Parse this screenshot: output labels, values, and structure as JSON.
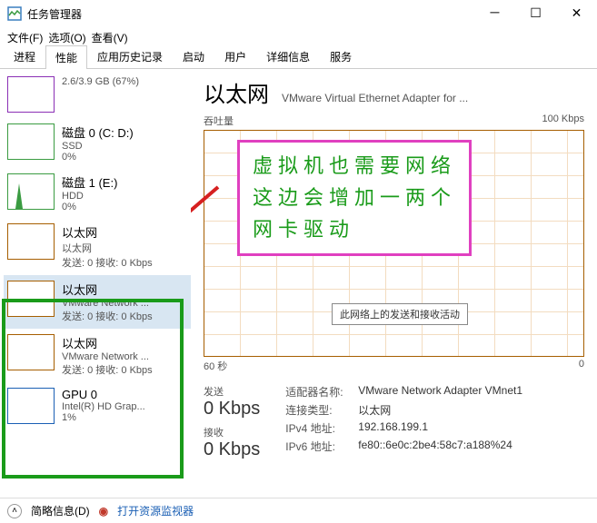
{
  "window": {
    "title": "任务管理器"
  },
  "menu": {
    "file": "文件(F)",
    "options": "选项(O)",
    "view": "查看(V)"
  },
  "tabs": {
    "processes": "进程",
    "performance": "性能",
    "app_history": "应用历史记录",
    "startup": "启动",
    "users": "用户",
    "details": "详细信息",
    "services": "服务"
  },
  "sidebar": [
    {
      "title": "",
      "sub": "2.6/3.9 GB (67%)",
      "sub2": "",
      "thumbClass": "thumb-mem"
    },
    {
      "title": "磁盘 0 (C: D:)",
      "sub": "SSD",
      "sub2": "0%",
      "thumbClass": "thumb-disk"
    },
    {
      "title": "磁盘 1 (E:)",
      "sub": "HDD",
      "sub2": "0%",
      "thumbClass": "thumb-disk",
      "spike": true
    },
    {
      "title": "以太网",
      "sub": "以太网",
      "sub2": "发送: 0 接收: 0 Kbps",
      "thumbClass": "thumb-eth"
    },
    {
      "title": "以太网",
      "sub": "VMware Network ...",
      "sub2": "发送: 0 接收: 0 Kbps",
      "thumbClass": "thumb-eth",
      "selected": true
    },
    {
      "title": "以太网",
      "sub": "VMware Network ...",
      "sub2": "发送: 0 接收: 0 Kbps",
      "thumbClass": "thumb-eth"
    },
    {
      "title": "GPU 0",
      "sub": "Intel(R) HD Grap...",
      "sub2": "1%",
      "thumbClass": "thumb-gpu"
    }
  ],
  "main": {
    "title": "以太网",
    "subtitle": "VMware Virtual Ethernet Adapter for ...",
    "chart_top_left": "吞吐量",
    "chart_top_right": "100 Kbps",
    "chart_bottom_left": "60 秒",
    "chart_bottom_right": "0",
    "tooltip": "此网络上的发送和接收活动",
    "stats": {
      "send_label": "发送",
      "send_value": "0 Kbps",
      "recv_label": "接收",
      "recv_value": "0 Kbps",
      "adapter_name_key": "适配器名称:",
      "adapter_name_val": "VMware Network Adapter VMnet1",
      "conn_type_key": "连接类型:",
      "conn_type_val": "以太网",
      "ipv4_key": "IPv4 地址:",
      "ipv4_val": "192.168.199.1",
      "ipv6_key": "IPv6 地址:",
      "ipv6_val": "fe80::6e0c:2be4:58c7:a188%24"
    }
  },
  "annotation": {
    "line1": "虚拟机也需要网络",
    "line2": "这边会增加一两个",
    "line3": "网卡驱动"
  },
  "footer": {
    "brief": "简略信息(D)",
    "resmon": "打开资源监视器"
  },
  "chart_data": {
    "type": "line",
    "title": "吞吐量",
    "xlabel": "60 秒",
    "ylabel": "",
    "ylim": [
      0,
      100
    ],
    "yunit": "Kbps",
    "x_range_seconds": 60,
    "series": [
      {
        "name": "发送",
        "values": [
          0,
          0,
          0,
          0,
          0,
          0,
          0,
          0,
          0,
          0,
          0,
          0
        ]
      },
      {
        "name": "接收",
        "values": [
          0,
          0,
          0,
          0,
          0,
          0,
          0,
          0,
          0,
          0,
          0,
          0
        ]
      }
    ]
  }
}
